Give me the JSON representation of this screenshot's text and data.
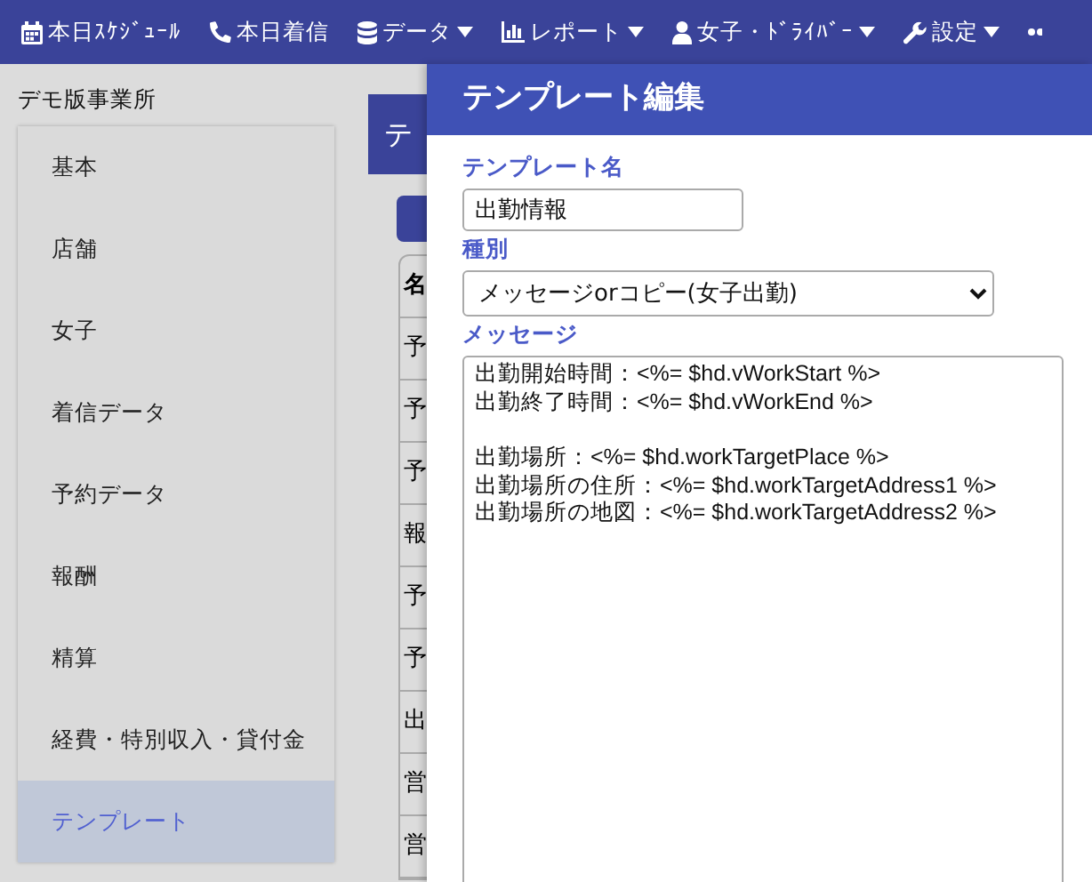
{
  "navbar": {
    "items": [
      {
        "label": "本日ｽｹｼﾞｭｰﾙ",
        "dropdown": false
      },
      {
        "label": "本日着信",
        "dropdown": false
      },
      {
        "label": "データ",
        "dropdown": true
      },
      {
        "label": "レポート",
        "dropdown": true
      },
      {
        "label": "女子・ﾄﾞﾗｲﾊﾞｰ",
        "dropdown": true
      },
      {
        "label": "設定",
        "dropdown": true
      },
      {
        "dropdown": false
      }
    ]
  },
  "office_name": "デモ版事業所",
  "sidebar": {
    "items": [
      {
        "label": "基本",
        "selected": false
      },
      {
        "label": "店舗",
        "selected": false
      },
      {
        "label": "女子",
        "selected": false
      },
      {
        "label": "着信データ",
        "selected": false
      },
      {
        "label": "予約データ",
        "selected": false
      },
      {
        "label": "報酬",
        "selected": false
      },
      {
        "label": "精算",
        "selected": false
      },
      {
        "label": "経費・特別収入・貸付金",
        "selected": false
      },
      {
        "label": "テンプレート",
        "selected": true
      }
    ]
  },
  "background_page": {
    "title": "テ",
    "table": {
      "header": "名",
      "rows": [
        "予",
        "予",
        "予",
        "報",
        "予",
        "予",
        "出",
        "営",
        "営"
      ]
    }
  },
  "drawer": {
    "title": "テンプレート編集",
    "name_label": "テンプレート名",
    "name_value": "出勤情報",
    "type_label": "種別",
    "type_value": "メッセージorコピー(女子出勤)",
    "message_label": "メッセージ",
    "message_value": "出勤開始時間：<%= $hd.vWorkStart %>\n出勤終了時間：<%= $hd.vWorkEnd %>\n\n出勤場所：<%= $hd.workTargetPlace %>\n出勤場所の住所：<%= $hd.workTargetAddress1 %>\n出勤場所の地図：<%= $hd.workTargetAddress2 %>"
  }
}
